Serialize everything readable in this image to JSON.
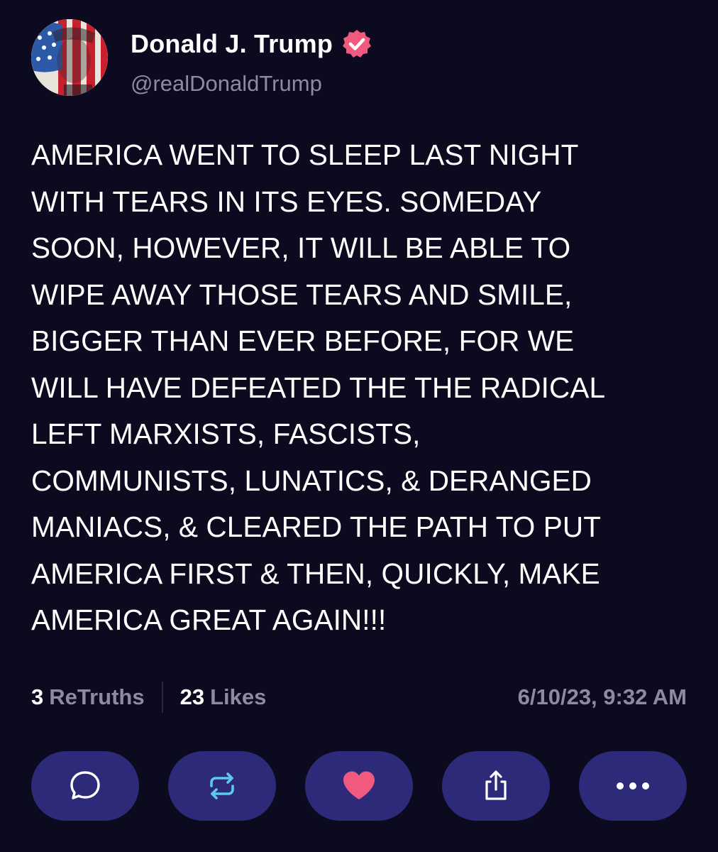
{
  "post": {
    "author": {
      "display_name": "Donald J. Trump",
      "handle": "@realDonaldTrump",
      "verified_icon": "verified-badge-icon",
      "verified_color": "#f05a7e"
    },
    "text_lines": [
      "AMERICA WENT TO SLEEP LAST NIGHT",
      "WITH TEARS IN ITS EYES. SOMEDAY",
      "SOON, HOWEVER, IT WILL BE ABLE TO",
      "WIPE AWAY THOSE TEARS AND SMILE,",
      "BIGGER THAN EVER BEFORE, FOR WE",
      "WILL HAVE DEFEATED THE THE RADICAL",
      "LEFT MARXISTS, FASCISTS,",
      "COMMUNISTS, LUNATICS, & DERANGED",
      "MANIACS, & CLEARED THE PATH TO PUT",
      "AMERICA FIRST & THEN, QUICKLY, MAKE",
      "AMERICA GREAT AGAIN!!!"
    ],
    "stats": {
      "retruths_count": "3",
      "retruths_label": "ReTruths",
      "likes_count": "23",
      "likes_label": "Likes",
      "timestamp": "6/10/23, 9:32 AM"
    },
    "actions": [
      {
        "icon": "reply-icon"
      },
      {
        "icon": "retruth-icon"
      },
      {
        "icon": "heart-icon"
      },
      {
        "icon": "share-icon"
      },
      {
        "icon": "more-icon"
      }
    ]
  },
  "colors": {
    "background": "#0c0a1f",
    "action_button": "#2e2a7a",
    "muted_text": "#8f8aa3",
    "retruth_accent": "#5ec8f0",
    "like_accent": "#f05a7e"
  }
}
